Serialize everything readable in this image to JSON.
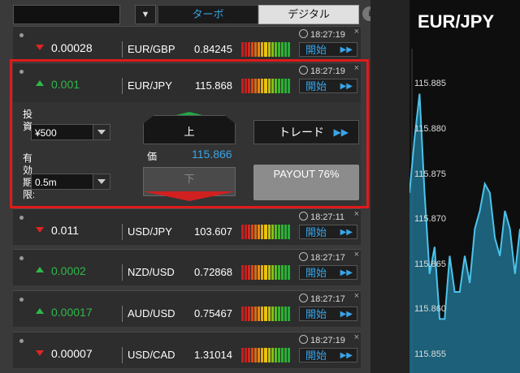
{
  "header": {
    "empty_field": "",
    "tabs": [
      "ターボ",
      "デジタル"
    ],
    "info_label": "i"
  },
  "rows": [
    {
      "direction": "down",
      "change": "0.00028",
      "pair": "EUR/GBP",
      "price": "0.84245",
      "time": "18:27:19",
      "action": "開始"
    },
    {
      "direction": "up",
      "change": "0.001",
      "pair": "EUR/JPY",
      "price": "115.868",
      "time": "18:27:19",
      "action": "開始"
    },
    {
      "direction": "down",
      "change": "0.011",
      "pair": "USD/JPY",
      "price": "103.607",
      "time": "18:27:11",
      "action": "開始"
    },
    {
      "direction": "up",
      "change": "0.0002",
      "pair": "NZD/USD",
      "price": "0.72868",
      "time": "18:27:17",
      "action": "開始"
    },
    {
      "direction": "up",
      "change": "0.00017",
      "pair": "AUD/USD",
      "price": "0.75467",
      "time": "18:27:17",
      "action": "開始"
    },
    {
      "direction": "down",
      "change": "0.00007",
      "pair": "USD/CAD",
      "price": "1.31014",
      "time": "18:27:19",
      "action": "開始"
    }
  ],
  "trade_panel": {
    "investment_label": "投資",
    "investment_value": "¥500",
    "expiry_label": "有効期限:",
    "expiry_value": "0.5m",
    "up_label": "上",
    "down_label": "下",
    "price_label": "価",
    "price_value": "115.866",
    "trade_button": "トレード",
    "payout": "PAYOUT 76%"
  },
  "chart": {
    "title": "EUR/JPY",
    "y_ticks": [
      "115.885",
      "115.880",
      "115.875",
      "115.870",
      "115.865",
      "115.860",
      "115.855"
    ]
  },
  "chart_data": {
    "type": "area",
    "title": "EUR/JPY",
    "ylim": [
      115.853,
      115.889
    ],
    "y": [
      115.873,
      115.879,
      115.884,
      115.873,
      115.864,
      115.867,
      115.859,
      115.859,
      115.866,
      115.862,
      115.862,
      115.866,
      115.863,
      115.869,
      115.871,
      115.874,
      115.873,
      115.868,
      115.866,
      115.871,
      115.869,
      115.864,
      115.869
    ],
    "color": "#2b8fb3"
  },
  "colors": {
    "accent_blue": "#39a4e8",
    "up_green": "#2fb84a",
    "down_red": "#e02424",
    "highlight_red": "#e01b1b"
  }
}
